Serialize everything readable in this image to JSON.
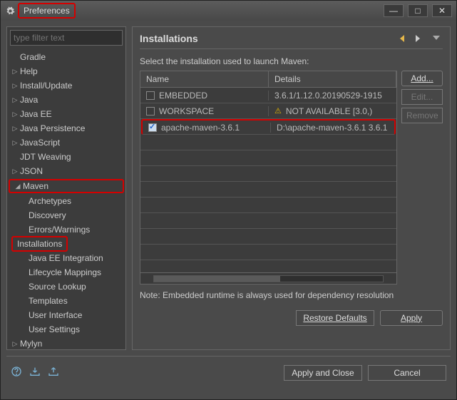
{
  "window": {
    "title": "Preferences"
  },
  "sidebar": {
    "filter_placeholder": "type filter text",
    "items": [
      {
        "label": "Gradle",
        "expandable": false
      },
      {
        "label": "Help",
        "expandable": true
      },
      {
        "label": "Install/Update",
        "expandable": true
      },
      {
        "label": "Java",
        "expandable": true
      },
      {
        "label": "Java EE",
        "expandable": true
      },
      {
        "label": "Java Persistence",
        "expandable": true
      },
      {
        "label": "JavaScript",
        "expandable": true
      },
      {
        "label": "JDT Weaving",
        "expandable": false
      },
      {
        "label": "JSON",
        "expandable": true
      }
    ],
    "maven": {
      "label": "Maven",
      "children": [
        {
          "label": "Archetypes"
        },
        {
          "label": "Discovery"
        },
        {
          "label": "Errors/Warnings"
        },
        {
          "label": "Installations"
        },
        {
          "label": "Java EE Integration"
        },
        {
          "label": "Lifecycle Mappings"
        },
        {
          "label": "Source Lookup"
        },
        {
          "label": "Templates"
        },
        {
          "label": "User Interface"
        },
        {
          "label": "User Settings"
        }
      ]
    },
    "tail": [
      {
        "label": "Mylyn",
        "expandable": true
      }
    ]
  },
  "content": {
    "heading": "Installations",
    "description": "Select the installation used to launch Maven:",
    "columns": {
      "name": "Name",
      "details": "Details"
    },
    "rows": [
      {
        "checked": false,
        "name": "EMBEDDED",
        "details": "3.6.1/1.12.0.20190529-1915",
        "warn": false
      },
      {
        "checked": false,
        "name": "WORKSPACE",
        "details": "NOT AVAILABLE [3.0,)",
        "warn": true
      },
      {
        "checked": true,
        "name": "apache-maven-3.6.1",
        "details": "D:\\apache-maven-3.6.1 3.6.1",
        "warn": false
      }
    ],
    "buttons": {
      "add": "Add...",
      "edit": "Edit...",
      "remove": "Remove"
    },
    "note": "Note: Embedded runtime is always used for dependency resolution",
    "restore": "Restore Defaults",
    "apply": "Apply"
  },
  "footer": {
    "apply_close": "Apply and Close",
    "cancel": "Cancel"
  }
}
